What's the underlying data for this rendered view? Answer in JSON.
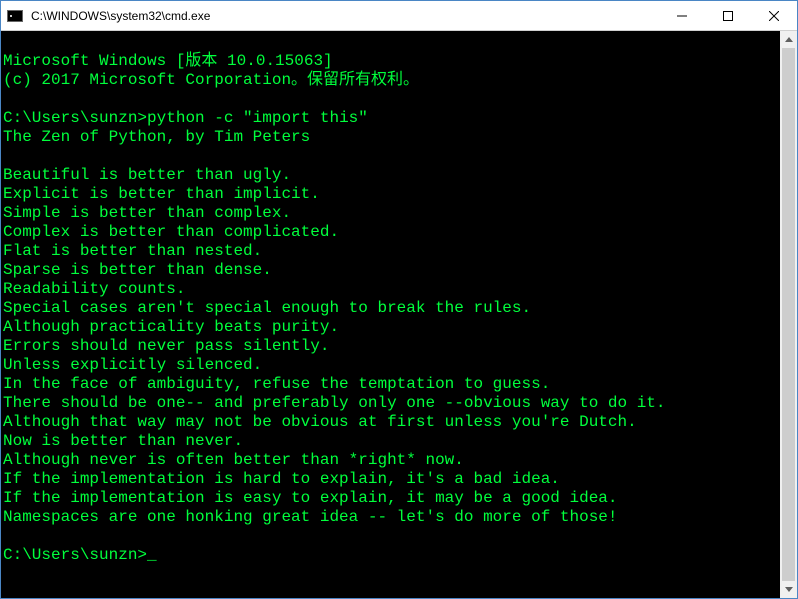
{
  "window": {
    "title": "C:\\WINDOWS\\system32\\cmd.exe"
  },
  "icons": {
    "minimize": "—",
    "maximize": "☐",
    "close": "✕"
  },
  "terminal": {
    "banner1": "Microsoft Windows [版本 10.0.15063]",
    "banner2": "(c) 2017 Microsoft Corporation。保留所有权利。",
    "blank1": "",
    "prompt1_path": "C:\\Users\\sunzn>",
    "prompt1_cmd": "python -c \"import this\"",
    "zen_title": "The Zen of Python, by Tim Peters",
    "blank2": "",
    "z1": "Beautiful is better than ugly.",
    "z2": "Explicit is better than implicit.",
    "z3": "Simple is better than complex.",
    "z4": "Complex is better than complicated.",
    "z5": "Flat is better than nested.",
    "z6": "Sparse is better than dense.",
    "z7": "Readability counts.",
    "z8": "Special cases aren't special enough to break the rules.",
    "z9": "Although practicality beats purity.",
    "z10": "Errors should never pass silently.",
    "z11": "Unless explicitly silenced.",
    "z12": "In the face of ambiguity, refuse the temptation to guess.",
    "z13": "There should be one-- and preferably only one --obvious way to do it.",
    "z14": "Although that way may not be obvious at first unless you're Dutch.",
    "z15": "Now is better than never.",
    "z16": "Although never is often better than *right* now.",
    "z17": "If the implementation is hard to explain, it's a bad idea.",
    "z18": "If the implementation is easy to explain, it may be a good idea.",
    "z19": "Namespaces are one honking great idea -- let's do more of those!",
    "blank3": "",
    "prompt2_path": "C:\\Users\\sunzn>",
    "cursor": "_"
  }
}
